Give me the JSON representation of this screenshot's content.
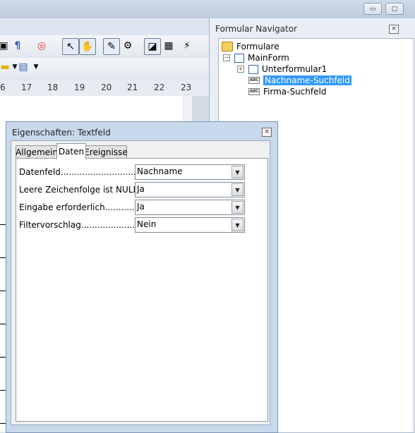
{
  "window": {
    "minimize_icon": "minimize-icon",
    "restore_icon": "restore-icon",
    "close_icon": "close-icon"
  },
  "ruler": {
    "ticks": [
      "6",
      "17",
      "18",
      "19",
      "20",
      "21",
      "22",
      "23"
    ]
  },
  "toolbar": {
    "icons": [
      "paste-icon",
      "formatting-marks-icon",
      "navigator-ring-icon",
      "select-pointer-icon",
      "hand-design-icon",
      "wizard-icon",
      "form-properties-icon",
      "design-mode-icon",
      "table-icon",
      "autopilot-icon",
      "highlight-icon",
      "paragraph-color-icon"
    ]
  },
  "navigator": {
    "title": "Formular Navigator",
    "root": "Formulare",
    "main_form": "MainForm",
    "items": [
      {
        "label": "Unterformular1",
        "icon": "form-icon"
      },
      {
        "label": "Nachname-Suchfeld",
        "icon": "textfield-icon"
      },
      {
        "label": "Firma-Suchfeld",
        "icon": "textfield-icon"
      }
    ]
  },
  "dialog": {
    "title": "Eigenschaften: Textfeld",
    "tabs": [
      "Allgemein",
      "Daten",
      "Ereignisse"
    ],
    "active_tab": "Daten",
    "rows": [
      {
        "label": "Datenfeld......................................",
        "value": "Nachname"
      },
      {
        "label": "Leere Zeichenfolge ist NULL.....",
        "value": "Ja"
      },
      {
        "label": "Eingabe erforderlich...................",
        "value": "Ja"
      },
      {
        "label": "Filtervorschlag............................",
        "value": "Nein"
      }
    ]
  },
  "colors": {
    "selection": "#3399ff",
    "dialog_frame": "#c9d9ec"
  }
}
